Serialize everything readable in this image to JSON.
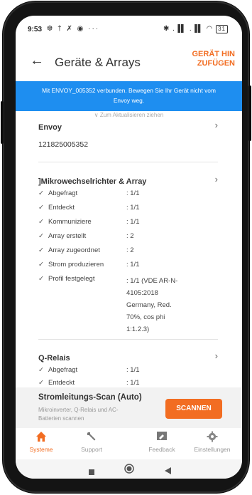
{
  "status_bar": {
    "time": "9:53",
    "left_icons": "❆ † ✗ ◉ ···",
    "right_icons": "✱ .▐▌ .▐▌ ◠",
    "battery": "31"
  },
  "app_bar": {
    "title": "Geräte & Arrays",
    "add_device_line1": "GERÄT HIN",
    "add_device_line2": "ZUFÜGEN"
  },
  "banner": {
    "line1": "Mit ENVOY_005352 verbunden. Bewegen Sie Ihr Gerät nicht vom",
    "line2": "Envoy weg."
  },
  "refresh_hint": "∨ Zum Aktualisieren ziehen",
  "envoy": {
    "title": "Envoy",
    "serial": "121825005352"
  },
  "micro": {
    "title": "]Mikrowechselrichter & Array",
    "rows": [
      {
        "label": "Abgefragt",
        "value": ": 1/1"
      },
      {
        "label": "Entdeckt",
        "value": ": 1/1"
      },
      {
        "label": "Kommuniziere",
        "value": ": 1/1"
      },
      {
        "label": "Array erstellt",
        "value": ": 2"
      },
      {
        "label": "Array zugeordnet",
        "value": ": 2"
      },
      {
        "label": "Strom produzieren",
        "value": ": 1/1"
      },
      {
        "label": "Profil festgelegt",
        "value": ": 1/1 (VDE AR-N-4105:2018 Germany, Red. 70%, cos phi 1:1.2.3)"
      }
    ]
  },
  "qrelais": {
    "title": "Q-Relais",
    "rows": [
      {
        "label": "Abgefragt",
        "value": ": 1/1"
      },
      {
        "label": "Entdeckt",
        "value": ": 1/1"
      }
    ]
  },
  "scan": {
    "title": "Stromleitungs-Scan (Auto)",
    "description": "Mikroinverter, Q-Relais und AC-Batterien scannen",
    "button": "SCANNEN"
  },
  "nav": {
    "systeme": "Systeme",
    "support": "Support",
    "feedback": "Feedback",
    "einstellungen": "Einstellungen"
  },
  "colors": {
    "accent": "#f26d22",
    "banner": "#1e8ef0"
  }
}
